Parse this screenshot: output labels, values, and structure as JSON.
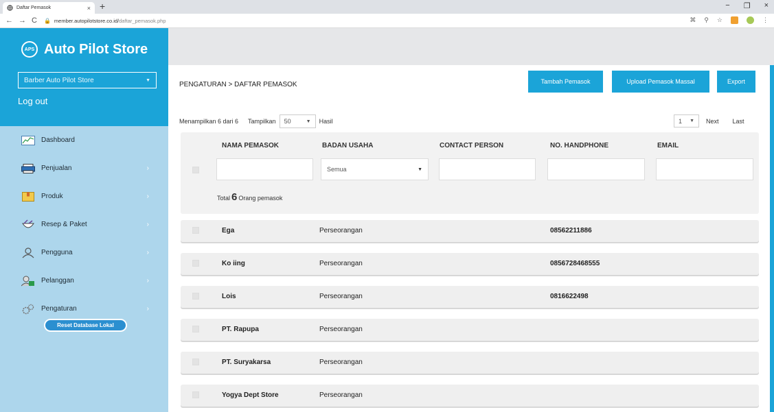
{
  "browser": {
    "tab_title": "Daftar Pemasok",
    "tab_close": "×",
    "new_tab": "+",
    "url_host": "member.autopilotstore.co.id/",
    "url_path": "daftar_pemasok.php",
    "window_controls": [
      "−",
      "❐",
      "×"
    ]
  },
  "sidebar": {
    "logo_mark": "APS",
    "app_name": "Auto Pilot Store",
    "store_select": "Barber Auto Pilot Store",
    "logout": "Log out",
    "items": [
      {
        "label": "Dashboard",
        "icon": "chart-icon",
        "chevron": ""
      },
      {
        "label": "Penjualan",
        "icon": "printer-icon",
        "chevron": "›"
      },
      {
        "label": "Produk",
        "icon": "box-icon",
        "chevron": "›"
      },
      {
        "label": "Resep & Paket",
        "icon": "mortar-icon",
        "chevron": "›"
      },
      {
        "label": "Pengguna",
        "icon": "user-icon",
        "chevron": "›"
      },
      {
        "label": "Pelanggan",
        "icon": "customer-icon",
        "chevron": "›"
      },
      {
        "label": "Pengaturan",
        "icon": "gears-icon",
        "chevron": "›"
      }
    ],
    "reset_button": "Reset Database Lokal"
  },
  "page": {
    "breadcrumb": "PENGATURAN > DAFTAR PEMASOK",
    "btn_tambah": "Tambah Pemasok",
    "btn_upload": "Upload Pemasok Massal",
    "btn_export": "Export",
    "showing_prefix": "Menampilkan 6 dari 6",
    "tampilkan_label": "Tampilkan",
    "page_size": "50",
    "hasil_label": "Hasil",
    "current_page": "1",
    "next": "Next",
    "last": "Last"
  },
  "table": {
    "columns": [
      "NAMA PEMASOK",
      "BADAN USAHA",
      "CONTACT PERSON",
      "NO. HANDPHONE",
      "EMAIL"
    ],
    "badan_usaha_filter": "Semua",
    "total_prefix": "Total",
    "total_count": "6",
    "total_suffix": "Orang pemasok",
    "rows": [
      {
        "nama": "Ega",
        "badan": "Perseorangan",
        "contact": "",
        "hp": "08562211886",
        "email": ""
      },
      {
        "nama": "Ko iing",
        "badan": "Perseorangan",
        "contact": "",
        "hp": "0856728468555",
        "email": ""
      },
      {
        "nama": "Lois",
        "badan": "Perseorangan",
        "contact": "",
        "hp": "0816622498",
        "email": ""
      },
      {
        "nama": "PT. Rapupa",
        "badan": "Perseorangan",
        "contact": "",
        "hp": "",
        "email": ""
      },
      {
        "nama": "PT. Suryakarsa",
        "badan": "Perseorangan",
        "contact": "",
        "hp": "",
        "email": ""
      },
      {
        "nama": "Yogya Dept Store",
        "badan": "Perseorangan",
        "contact": "",
        "hp": "",
        "email": ""
      }
    ]
  },
  "colors": {
    "primary": "#1ba4d8",
    "sidebar_bg": "#add6ec",
    "row_bg": "#efefef"
  }
}
